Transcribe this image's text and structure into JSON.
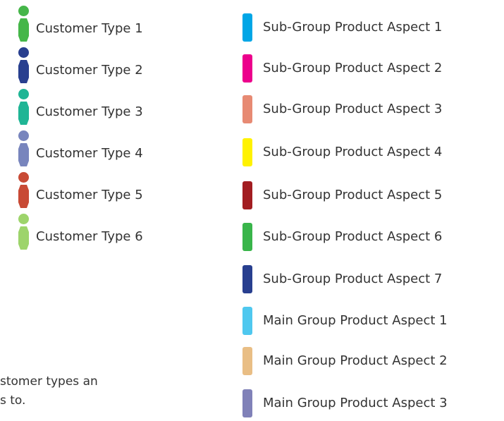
{
  "customer_legend": [
    {
      "label": "Customer Type 1",
      "color": "#45b649"
    },
    {
      "label": "Customer Type 2",
      "color": "#283f8f"
    },
    {
      "label": "Customer Type 3",
      "color": "#1fb595"
    },
    {
      "label": "Customer Type 4",
      "color": "#7885bd"
    },
    {
      "label": "Customer Type 5",
      "color": "#c84a35"
    },
    {
      "label": "Customer Type 6",
      "color": "#9dd46b"
    }
  ],
  "aspect_legend": [
    {
      "label": "Sub-Group Product Aspect 1",
      "color": "#00a6e6"
    },
    {
      "label": "Sub-Group Product Aspect 2",
      "color": "#ec008c"
    },
    {
      "label": "Sub-Group Product Aspect 3",
      "color": "#e78a73"
    },
    {
      "label": "Sub-Group Product Aspect 4",
      "color": "#fff200"
    },
    {
      "label": "Sub-Group Product Aspect 5",
      "color": "#a21d21"
    },
    {
      "label": "Sub-Group Product Aspect 6",
      "color": "#39b54a"
    },
    {
      "label": "Sub-Group Product Aspect 7",
      "color": "#283f8f"
    },
    {
      "label": "Main Group Product Aspect 1",
      "color": "#4fc8ef"
    },
    {
      "label": "Main Group Product Aspect 2",
      "color": "#e9be85"
    },
    {
      "label": "Main Group Product Aspect 3",
      "color": "#8081b8"
    }
  ],
  "caption": {
    "line1": "stomer types an",
    "line2": "s to."
  }
}
